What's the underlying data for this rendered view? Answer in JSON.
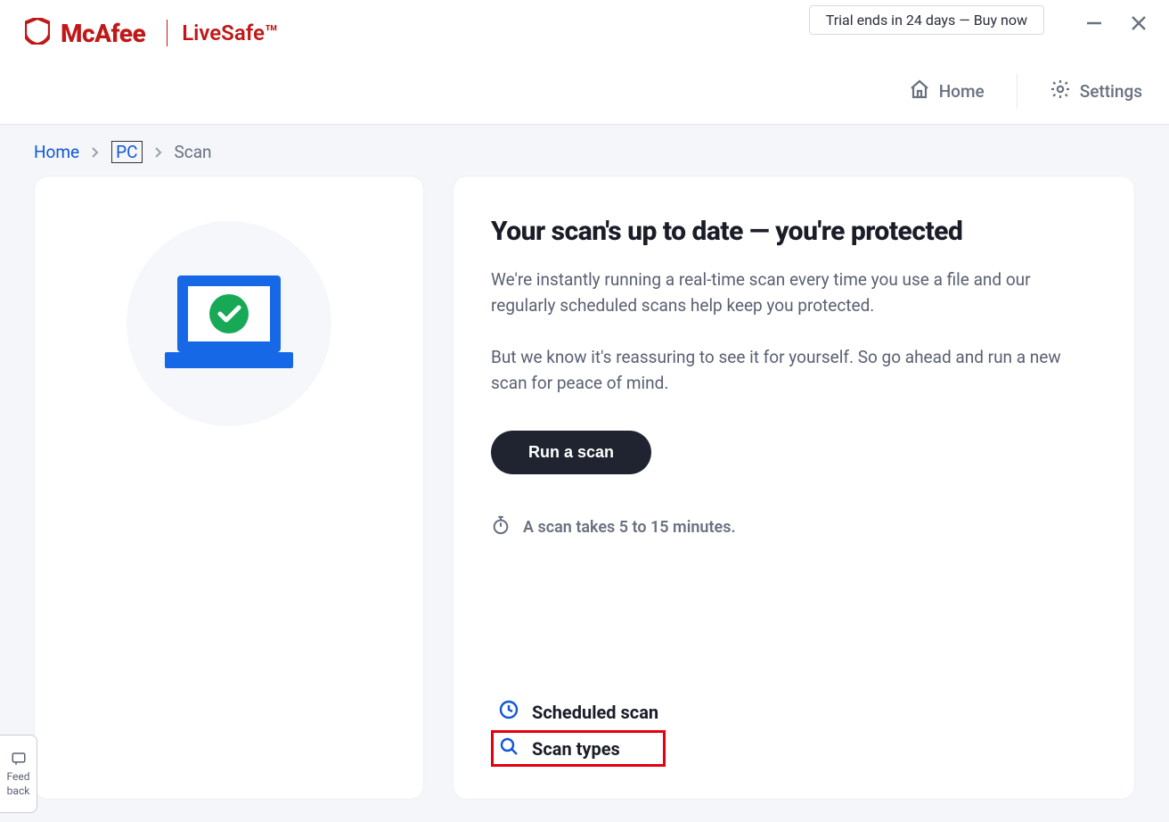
{
  "brand": {
    "name": "McAfee",
    "product": "LiveSafe™"
  },
  "trial": {
    "text": "Trial ends in 24 days — Buy now"
  },
  "nav": {
    "home": "Home",
    "settings": "Settings"
  },
  "breadcrumb": {
    "home": "Home",
    "pc": "PC",
    "current": "Scan"
  },
  "main": {
    "headline": "Your scan's up to date — you're protected",
    "para1": "We're instantly running a real-time scan every time you use a file and our regularly scheduled scans help keep you protected.",
    "para2": "But we know it's reassuring to see it for yourself. So go ahead and run a new scan for peace of mind.",
    "run_button": "Run a scan",
    "duration": "A scan takes 5 to 15 minutes."
  },
  "links": {
    "scheduled": "Scheduled scan",
    "types": "Scan types"
  },
  "feedback": {
    "line1": "Feed",
    "line2": "back"
  }
}
